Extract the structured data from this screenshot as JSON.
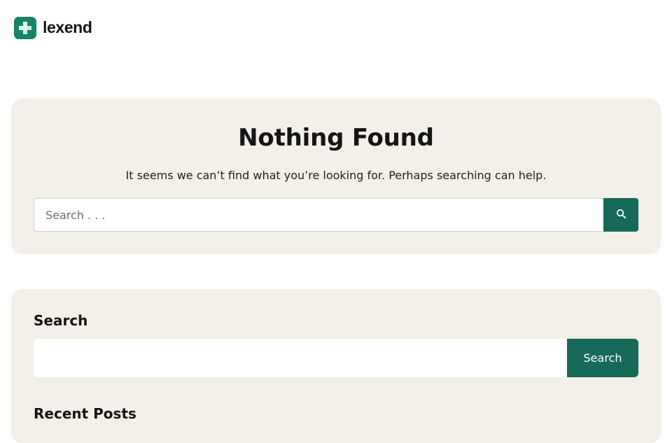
{
  "site": {
    "brand": "lexend",
    "brand_color": "#178467"
  },
  "no_results": {
    "title": "Nothing Found",
    "message": "It seems we can’t find what you’re looking for. Perhaps searching can help.",
    "search_placeholder": "Search . . .",
    "search_value": "",
    "search_icon": "search-icon",
    "button_color": "#176a57"
  },
  "sidebar": {
    "search_widget": {
      "title": "Search",
      "input_value": "",
      "button_label": "Search"
    },
    "recent_posts": {
      "title": "Recent Posts"
    }
  }
}
